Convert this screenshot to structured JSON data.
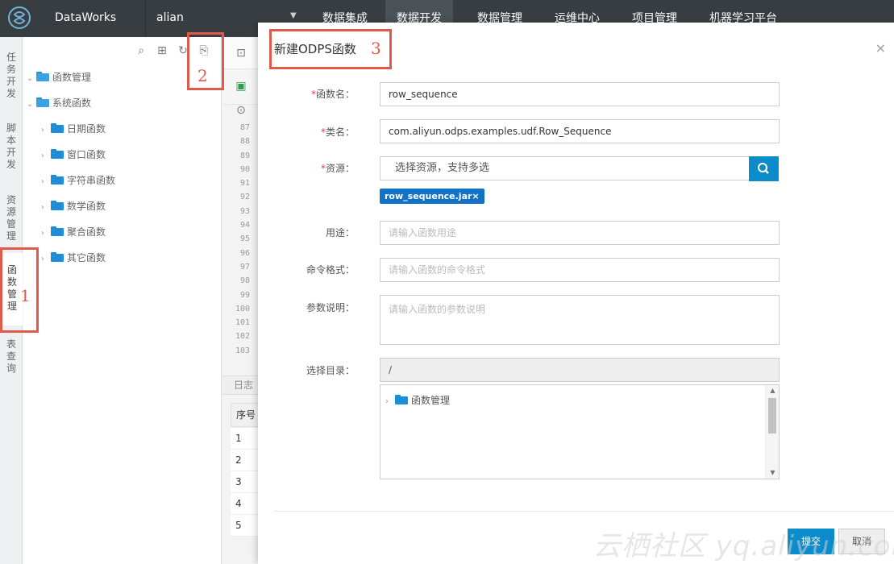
{
  "topbar": {
    "brand": "DataWorks",
    "project": "alian",
    "nav": [
      {
        "label": "数据集成",
        "active": false
      },
      {
        "label": "数据开发",
        "active": true
      },
      {
        "label": "数据管理",
        "active": false
      },
      {
        "label": "运维中心",
        "active": false
      },
      {
        "label": "项目管理",
        "active": false
      },
      {
        "label": "机器学习平台",
        "active": false
      }
    ]
  },
  "vtabs": [
    {
      "label": "任务开发"
    },
    {
      "label": "脚本开发"
    },
    {
      "label": "资源管理"
    },
    {
      "label": "函数管理",
      "active": true
    },
    {
      "label": "表查询"
    }
  ],
  "tree": {
    "root": "函数管理",
    "system": "系统函数",
    "children": [
      "日期函数",
      "窗口函数",
      "字符串函数",
      "数学函数",
      "聚合函数",
      "其它函数"
    ]
  },
  "editor": {
    "line_numbers": [
      "87",
      "88",
      "89",
      "90",
      "91",
      "92",
      "93",
      "94",
      "95",
      "96",
      "97",
      "98",
      "99",
      "100",
      "101",
      "102",
      "103"
    ],
    "log_tab": "日志",
    "grid_header": "序号",
    "grid_rows": [
      "1",
      "2",
      "3",
      "4",
      "5"
    ]
  },
  "modal": {
    "title": "新建ODPS函数",
    "close": "×",
    "fields": {
      "func_name_label": "函数名：",
      "func_name_value": "row_sequence",
      "class_label": "类名：",
      "class_value": "com.aliyun.odps.examples.udf.Row_Sequence",
      "resource_label": "资源：",
      "resource_placeholder": "选择资源，支持多选",
      "resource_tag": "row_sequence.jar×",
      "usage_label": "用途：",
      "usage_placeholder": "请输入函数用途",
      "command_label": "命令格式：",
      "command_placeholder": "请输入函数的命令格式",
      "params_label": "参数说明：",
      "params_placeholder": "请输入函数的参数说明",
      "dir_label": "选择目录：",
      "dir_value": "/",
      "dir_tree_item": "函数管理"
    },
    "submit": "提交",
    "cancel": "取消"
  },
  "required_mark": "*",
  "annotations": [
    "1",
    "2",
    "3"
  ],
  "watermark": "云栖社区 yq.aliyun.com",
  "colors": {
    "topbar": "#373d41",
    "primary": "#0c8cca",
    "tag": "#1172c6",
    "annotation": "#e05a4a"
  }
}
